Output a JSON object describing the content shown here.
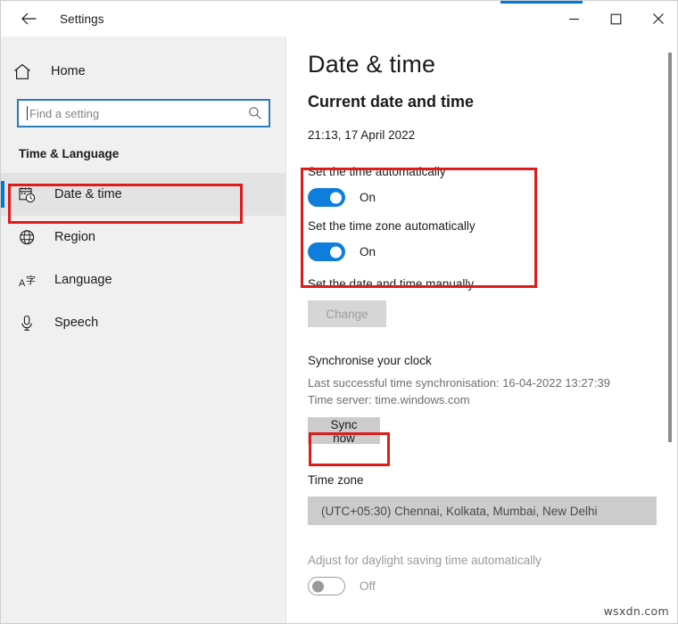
{
  "window": {
    "title": "Settings",
    "back_icon": "back-arrow-icon",
    "minimize_label": "—",
    "maximize_label": "☐",
    "close_label": "✕",
    "accent_color": "#0078d4"
  },
  "sidebar": {
    "home_label": "Home",
    "home_icon": "home-icon",
    "search": {
      "placeholder": "Find a setting",
      "value": "",
      "icon": "search-icon"
    },
    "section_title": "Time & Language",
    "items": [
      {
        "label": "Date & time",
        "icon": "calendar-clock-icon",
        "selected": true
      },
      {
        "label": "Region",
        "icon": "globe-icon",
        "selected": false
      },
      {
        "label": "Language",
        "icon": "language-icon",
        "selected": false
      },
      {
        "label": "Speech",
        "icon": "microphone-icon",
        "selected": false
      }
    ]
  },
  "main": {
    "page_title": "Date & time",
    "current_section_heading": "Current date and time",
    "current_datetime": "21:13, 17 April 2022",
    "set_time_auto": {
      "label": "Set the time automatically",
      "state": "On",
      "on": true
    },
    "set_timezone_auto": {
      "label": "Set the time zone automatically",
      "state": "On",
      "on": true
    },
    "set_manually": {
      "label": "Set the date and time manually",
      "button_label": "Change",
      "button_disabled": true
    },
    "sync": {
      "heading": "Synchronise your clock",
      "last_sync": "Last successful time synchronisation: 16-04-2022 13:27:39",
      "time_server": "Time server: time.windows.com",
      "button_label": "Sync now"
    },
    "timezone": {
      "heading": "Time zone",
      "selected": "(UTC+05:30) Chennai, Kolkata, Mumbai, New Delhi"
    },
    "daylight": {
      "label": "Adjust for daylight saving time automatically",
      "state": "Off",
      "on": false
    }
  },
  "annotations": {
    "highlight_color": "#e01b1b"
  },
  "watermark": "wsxdn.com"
}
